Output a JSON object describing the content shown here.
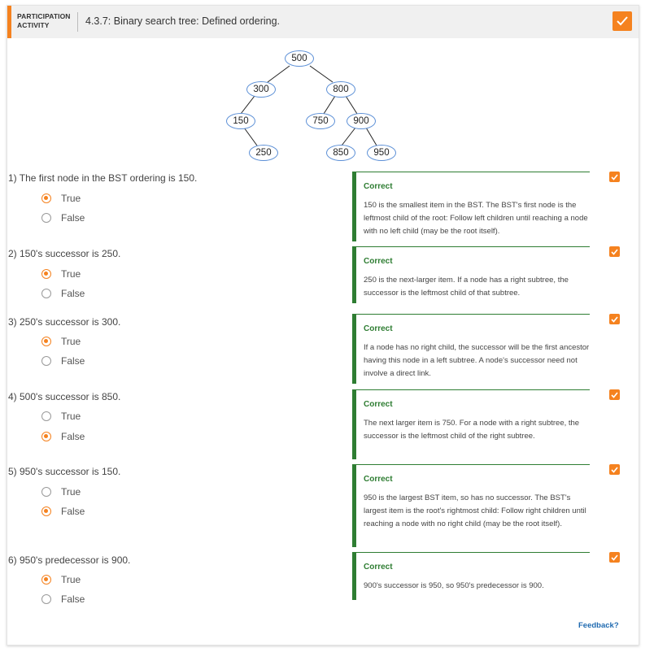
{
  "header": {
    "kind_line1": "PARTICIPATION",
    "kind_line2": "ACTIVITY",
    "title": "4.3.7: Binary search tree: Defined ordering."
  },
  "tree": {
    "nodes": [
      "500",
      "300",
      "800",
      "150",
      "750",
      "900",
      "250",
      "850",
      "950"
    ]
  },
  "questions": [
    {
      "label": "1)  The first node in the BST ordering is 150.",
      "options": [
        "True",
        "False"
      ],
      "selected": 0,
      "feedback_title": "Correct",
      "feedback_text": "150 is the smallest item in the BST. The BST's first node is the leftmost child of the root: Follow left children until reaching a node with no left child (may be the root itself)."
    },
    {
      "label": "2)  150's successor is 250.",
      "options": [
        "True",
        "False"
      ],
      "selected": 0,
      "feedback_title": "Correct",
      "feedback_text": "250 is the next-larger item. If a node has a right subtree, the successor is the leftmost child of that subtree."
    },
    {
      "label": "3)  250's successor is 300.",
      "options": [
        "True",
        "False"
      ],
      "selected": 0,
      "feedback_title": "Correct",
      "feedback_text": "If a node has no right child, the successor will be the first ancestor having this node in a left subtree. A node's successor need not involve a direct link."
    },
    {
      "label": "4)  500's successor is 850.",
      "options": [
        "True",
        "False"
      ],
      "selected": 1,
      "feedback_title": "Correct",
      "feedback_text": "The next larger item is 750. For a node with a right subtree, the successor is the leftmost child of the right subtree."
    },
    {
      "label": "5)  950's successor is 150.",
      "options": [
        "True",
        "False"
      ],
      "selected": 1,
      "feedback_title": "Correct",
      "feedback_text": "950 is the largest BST item, so has no successor. The BST's largest item is the root's rightmost child: Follow right children until reaching a node with no right child (may be the root itself)."
    },
    {
      "label": "6)  950's predecessor is 900.",
      "options": [
        "True",
        "False"
      ],
      "selected": 0,
      "feedback_title": "Correct",
      "feedback_text": "900's successor is 950, so 950's predecessor is 900."
    }
  ],
  "footer": {
    "feedback_link": "Feedback?"
  },
  "colors": {
    "accent": "#f5821f",
    "correct": "#2e7d32",
    "node_border": "#5b8fd6",
    "link": "#1f6ab0"
  },
  "icons": {
    "completed": "check-icon"
  }
}
